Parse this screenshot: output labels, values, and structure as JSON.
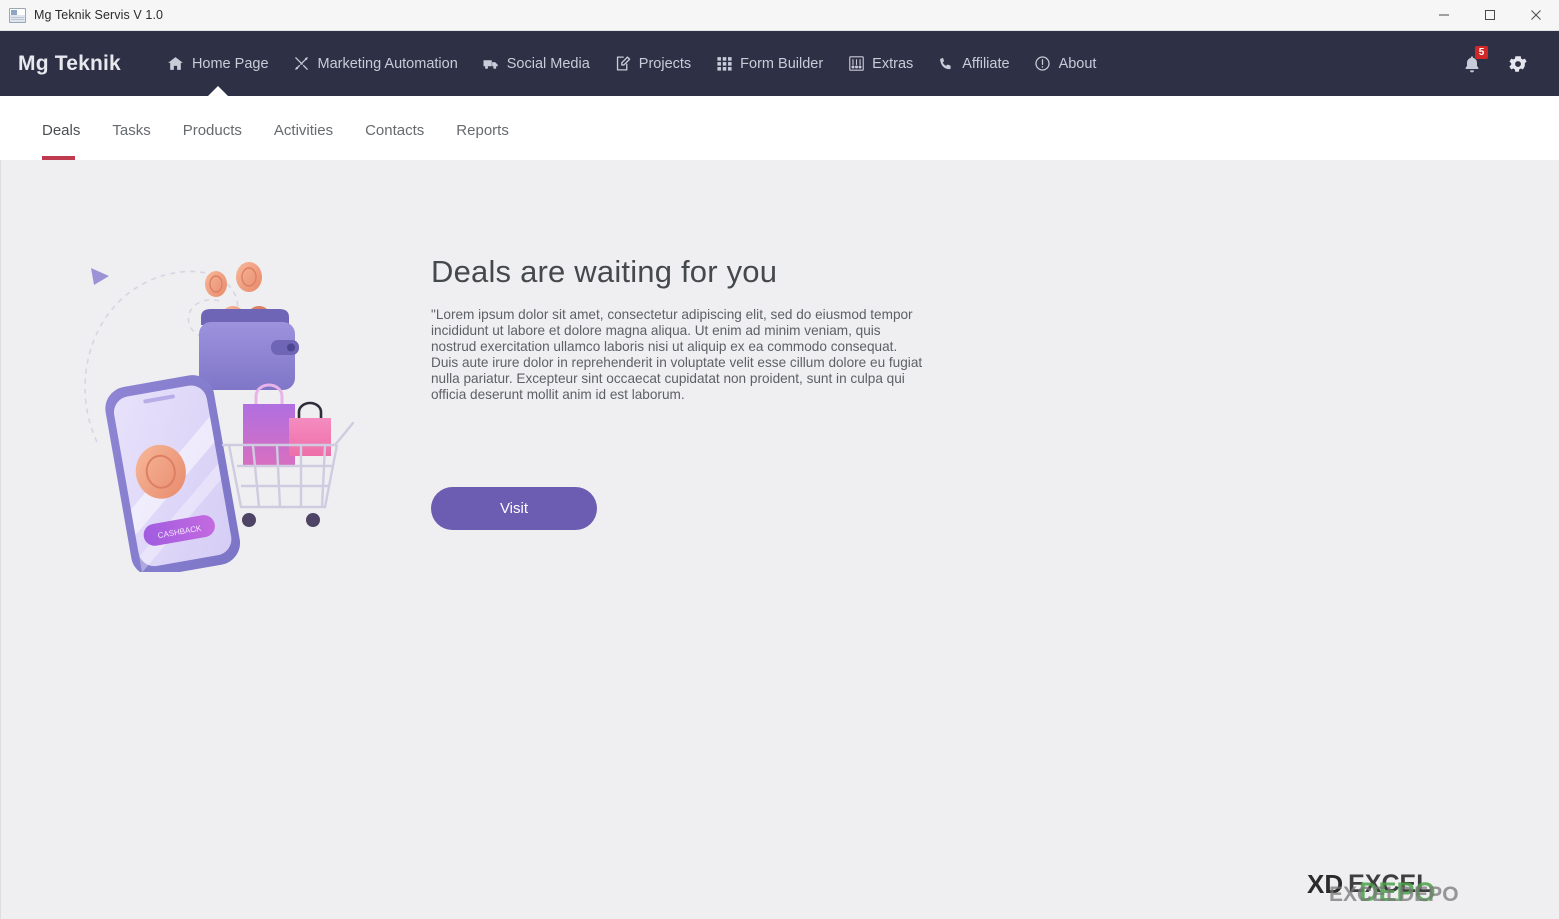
{
  "window": {
    "title": "Mg Teknik Servis V 1.0",
    "icon": "app-window-icon",
    "controls": {
      "minimize": "minimize-button",
      "maximize": "maximize-button",
      "close": "close-button"
    }
  },
  "topnav": {
    "brand": "Mg Teknik",
    "background": "#2e3145",
    "items": [
      {
        "label": "Home Page",
        "icon": "home-icon",
        "active": true
      },
      {
        "label": "Marketing Automation",
        "icon": "tools-icon",
        "active": false
      },
      {
        "label": "Social Media",
        "icon": "truck-icon",
        "active": false
      },
      {
        "label": "Projects",
        "icon": "clipboard-pencil-icon",
        "active": false
      },
      {
        "label": "Form Builder",
        "icon": "grid-icon",
        "active": false
      },
      {
        "label": "Extras",
        "icon": "sliders-icon",
        "active": false
      },
      {
        "label": "Affiliate",
        "icon": "phone-icon",
        "active": false
      },
      {
        "label": "About",
        "icon": "info-circle-icon",
        "active": false
      }
    ],
    "notifications": {
      "icon": "bell-icon",
      "count": "5",
      "badge_color": "#d32727"
    },
    "settings": {
      "icon": "gear-icon"
    }
  },
  "subtabs": {
    "active_index": 0,
    "accent_color": "#bf3a4e",
    "items": [
      {
        "label": "Deals"
      },
      {
        "label": "Tasks"
      },
      {
        "label": "Products"
      },
      {
        "label": "Activities"
      },
      {
        "label": "Contacts"
      },
      {
        "label": "Reports"
      }
    ]
  },
  "main": {
    "background": "#efeff1",
    "illustration": "shopping-cashback-illustration",
    "phone_label": "CASHBACK",
    "title": "Deals are waiting for you",
    "body": "\"Lorem ipsum dolor sit amet, consectetur adipiscing elit, sed do eiusmod tempor incididunt ut labore et dolore magna aliqua. Ut enim ad minim veniam, quis nostrud exercitation ullamco laboris nisi ut aliquip ex ea commodo consequat. Duis aute irure dolor in reprehenderit in voluptate velit esse cillum dolore eu fugiat nulla pariatur. Excepteur sint occaecat cupidatat non proident, sunt in culpa qui officia deserunt mollit anim id est laborum.",
    "cta": {
      "label": "Visit",
      "color": "#6c5cb2"
    }
  },
  "watermark": {
    "primary": "EXCEL",
    "secondary": "DEPO",
    "tertiary": "EXCELDEPO",
    "mark": "XD"
  }
}
